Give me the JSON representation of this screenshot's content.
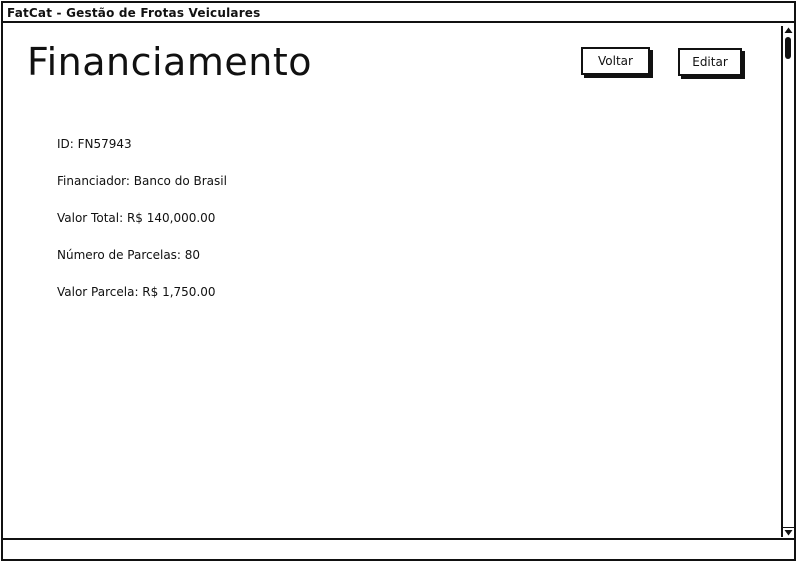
{
  "window": {
    "title": "FatCat - Gestão de Frotas Veiculares"
  },
  "page": {
    "title": "Financiamento"
  },
  "toolbar": {
    "back_label": "Voltar",
    "edit_label": "Editar"
  },
  "financing": {
    "id_line": "ID: FN57943",
    "lender_line": "Financiador: Banco do Brasil",
    "total_line": "Valor Total: R$ 140,000.00",
    "installments_line": "Número de Parcelas: 80",
    "installment_value_line": "Valor Parcela: R$ 1,750.00"
  },
  "scrollbar": {
    "up_icon": "arrow-up-icon",
    "down_icon": "arrow-down-icon"
  }
}
